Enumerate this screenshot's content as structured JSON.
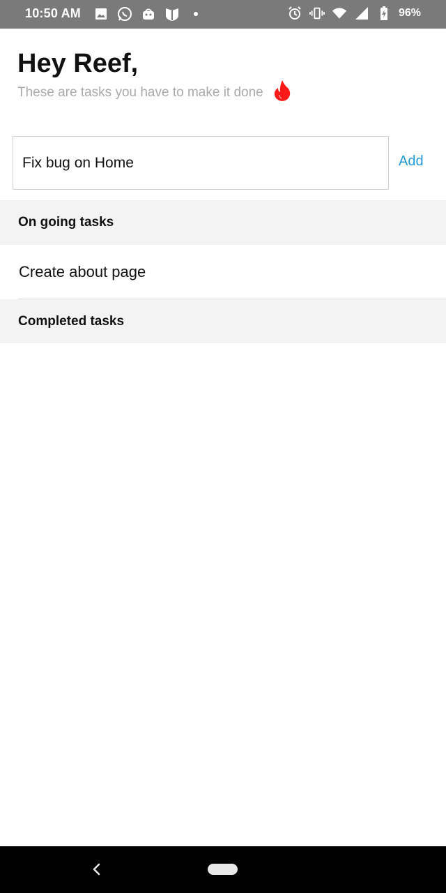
{
  "status_bar": {
    "time": "10:50 AM",
    "battery_percent": "96%",
    "left_icons": [
      "image-icon",
      "whatsapp-icon",
      "bag-icon",
      "shield-icon",
      "dot-icon"
    ],
    "right_icons": [
      "alarm-icon",
      "vibrate-icon",
      "wifi-icon",
      "signal-icon",
      "battery-charging-icon"
    ]
  },
  "header": {
    "greeting": "Hey Reef,",
    "subtitle": "These are tasks you have to make it done",
    "emoji_icon": "fire-icon"
  },
  "new_task": {
    "value": "Fix bug on Home",
    "add_label": "Add"
  },
  "ongoing": {
    "title": "On going tasks",
    "items": [
      {
        "label": "Create about page"
      }
    ]
  },
  "completed": {
    "title": "Completed tasks",
    "items": []
  },
  "colors": {
    "accent": "#1e9ad6",
    "status_bar": "#7a7a7a",
    "section_bg": "#f3f3f3",
    "fire": "#ff1a1a"
  }
}
